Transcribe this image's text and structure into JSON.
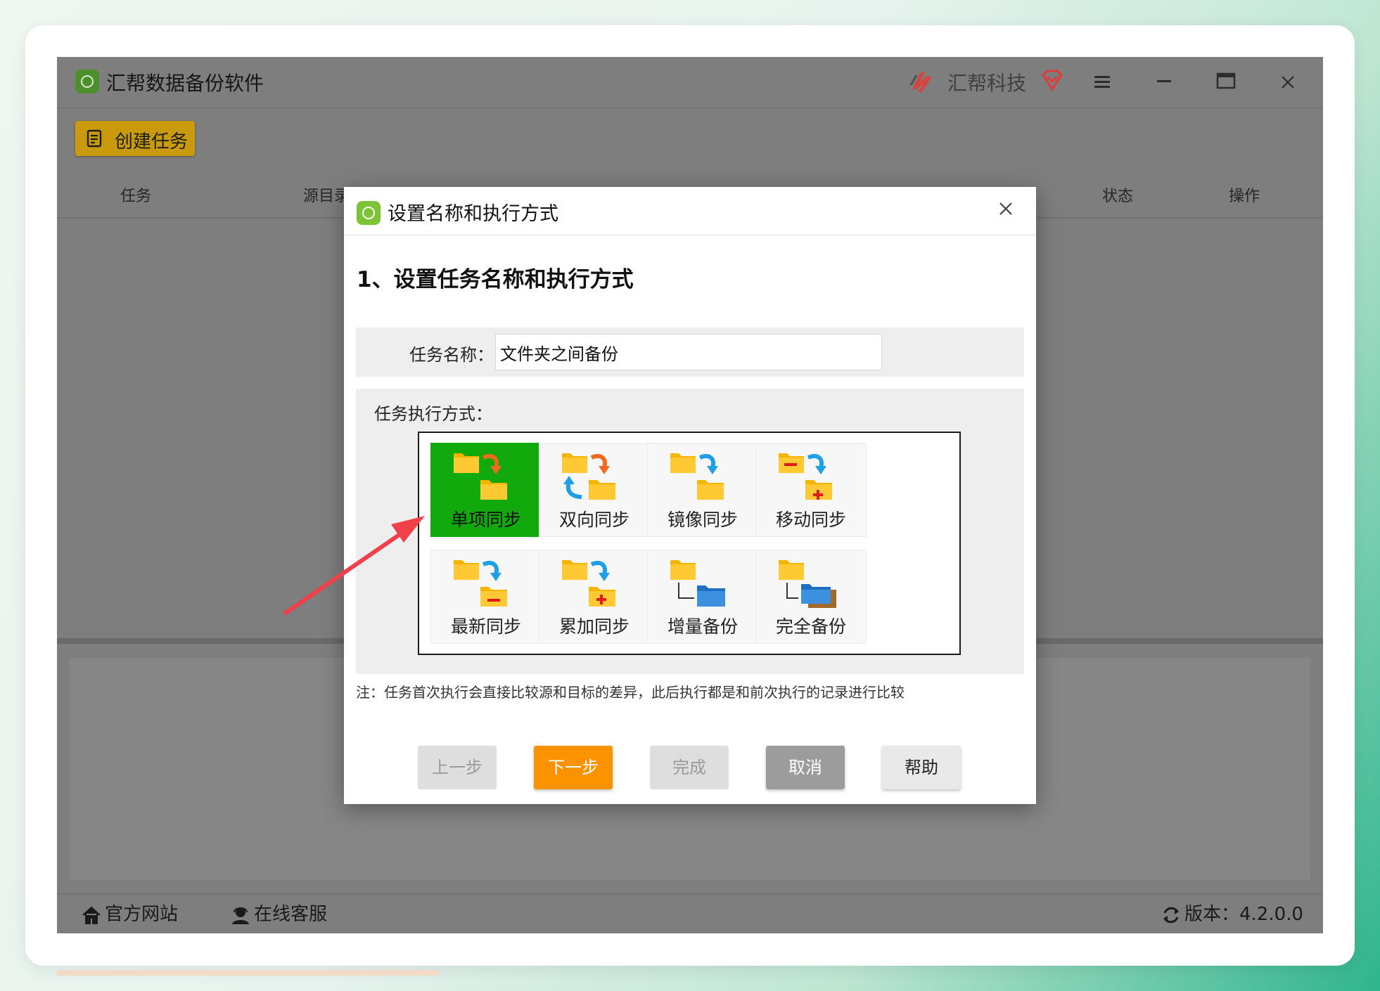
{
  "app": {
    "title": "汇帮数据备份软件",
    "brand": "汇帮科技",
    "create_task_label": "创建任务",
    "columns": {
      "task": "任务",
      "source": "源目录",
      "status": "状态",
      "action": "操作"
    },
    "footer": {
      "website_label": "官方网站",
      "support_label": "在线客服",
      "version_label": "版本：4.2.0.0"
    }
  },
  "modal": {
    "title": "设置名称和执行方式",
    "step_heading": "1、设置任务名称和执行方式",
    "name_label": "任务名称：",
    "name_value": "文件夹之间备份",
    "mode_label": "任务执行方式：",
    "modes": [
      {
        "label": "单项同步",
        "icon": "one-way-sync-icon",
        "selected": true
      },
      {
        "label": "双向同步",
        "icon": "two-way-sync-icon",
        "selected": false
      },
      {
        "label": "镜像同步",
        "icon": "mirror-sync-icon",
        "selected": false
      },
      {
        "label": "移动同步",
        "icon": "move-sync-icon",
        "selected": false
      },
      {
        "label": "最新同步",
        "icon": "latest-sync-icon",
        "selected": false
      },
      {
        "label": "累加同步",
        "icon": "cumulative-sync-icon",
        "selected": false
      },
      {
        "label": "增量备份",
        "icon": "incremental-backup-icon",
        "selected": false
      },
      {
        "label": "完全备份",
        "icon": "full-backup-icon",
        "selected": false
      }
    ],
    "note": "注：任务首次执行会直接比较源和目标的差异，此后执行都是和前次执行的记录进行比较",
    "buttons": {
      "prev": "上一步",
      "next": "下一步",
      "finish": "完成",
      "cancel": "取消",
      "help": "帮助"
    }
  },
  "colors": {
    "selected_tile": "#12a90d",
    "next_button": "#fb9300",
    "create_button": "#c99a0c",
    "annotation_arrow": "#f0404a"
  }
}
